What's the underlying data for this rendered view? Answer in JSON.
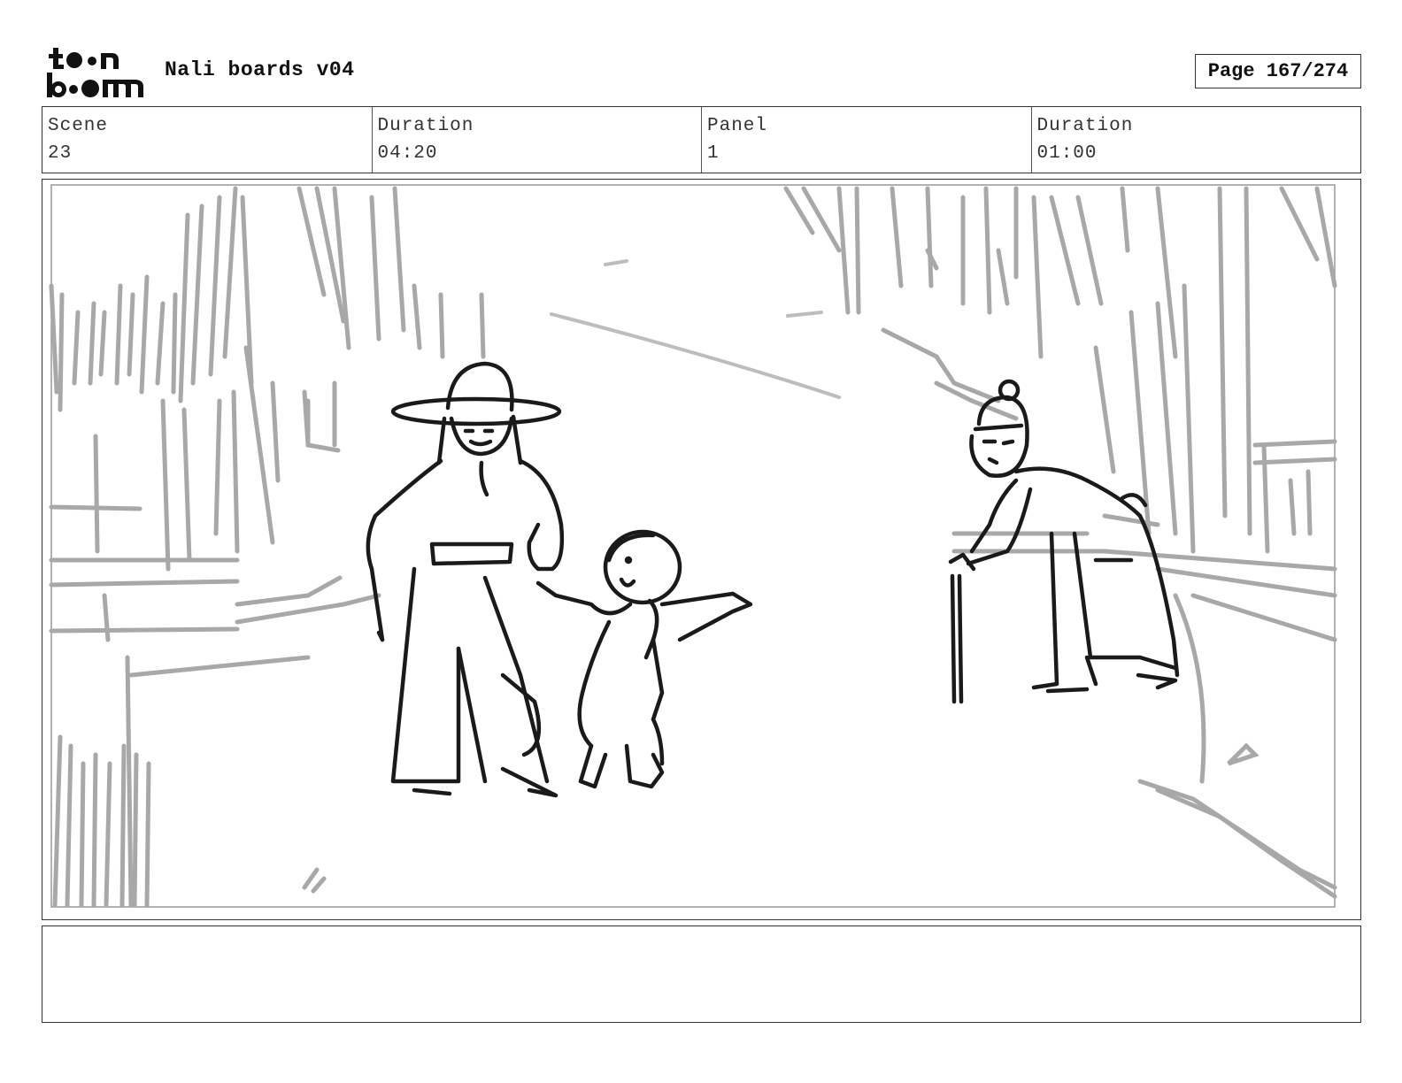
{
  "header": {
    "logo_text_top": "toon",
    "logo_text_bottom": "boom",
    "project_title": "Nali boards v04",
    "page_label": "Page 167/274"
  },
  "info": {
    "scene_label": "Scene",
    "scene_value": "23",
    "scene_duration_label": "Duration",
    "scene_duration_value": "04:20",
    "panel_label": "Panel",
    "panel_value": "1",
    "panel_duration_label": "Duration",
    "panel_duration_value": "01:00"
  },
  "notes": {
    "text": ""
  },
  "panel": {
    "image": "storyboard-sketch",
    "description_icons": [
      "man-with-hat-figure",
      "child-figure",
      "elder-with-cane-figure"
    ]
  }
}
